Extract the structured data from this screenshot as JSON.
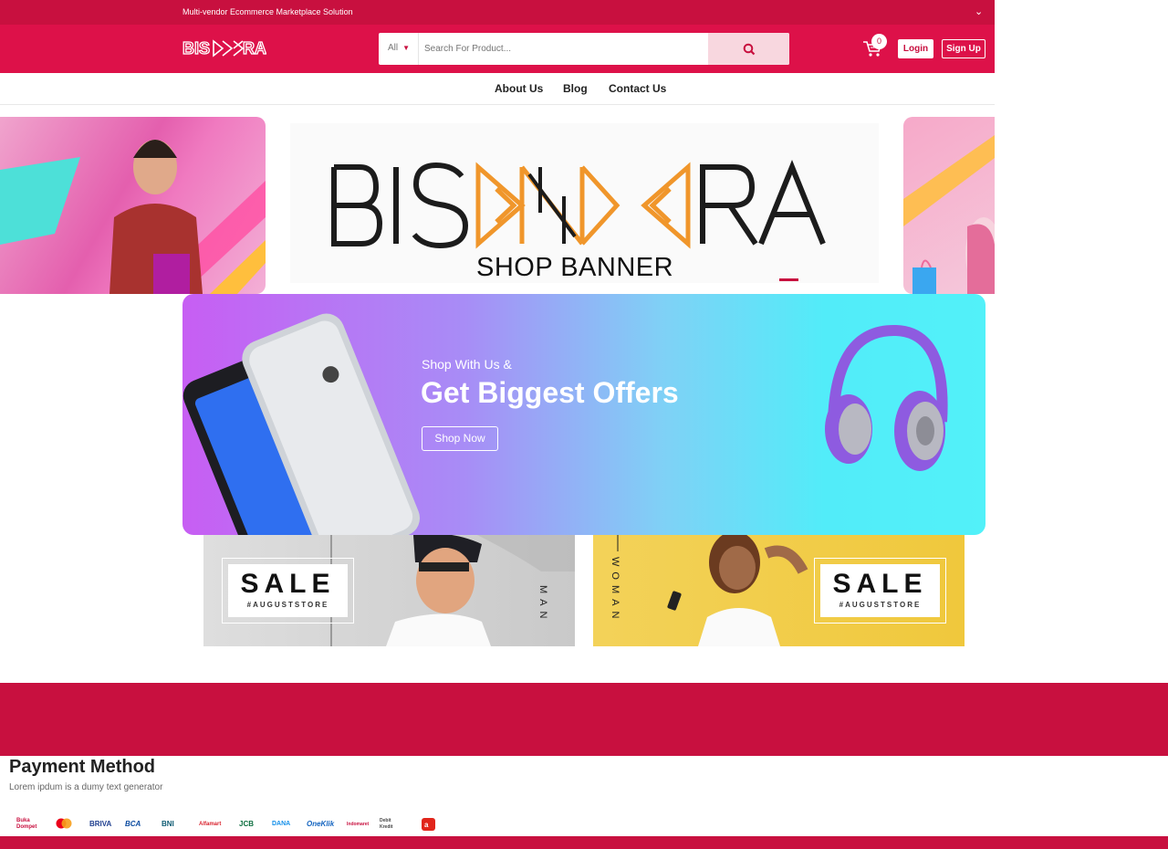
{
  "topbar": {
    "tagline": "Multi-vendor Ecommerce Marketplace Solution"
  },
  "header": {
    "search": {
      "category": "All",
      "placeholder": "Search For Product..."
    },
    "cart_count": "0",
    "login_label": "Login",
    "signup_label": "Sign Up"
  },
  "nav": {
    "items": [
      "About Us",
      "Blog",
      "Contact Us"
    ]
  },
  "carousel": {
    "logo_text": "BISNARA",
    "caption": "SHOP BANNER"
  },
  "promo": {
    "subtitle": "Shop With Us &",
    "title": "Get Biggest Offers",
    "button": "Shop Now"
  },
  "sale_man": {
    "word": "SALE",
    "tag": "#AUGUSTSTORE",
    "side": "MAN"
  },
  "sale_woman": {
    "word": "SALE",
    "tag": "#AUGUSTSTORE",
    "side": "WOMAN"
  },
  "payment": {
    "title": "Payment Method",
    "subtitle": "Lorem ipdum is a dumy text generator",
    "methods": [
      "Buka Dompet",
      "Mastercard",
      "BRIVA",
      "BCA",
      "BNI",
      "Alfamart",
      "JCB",
      "DANA",
      "OneKlik",
      "Indomaret",
      "Debit Kredit",
      "Akulaku"
    ]
  },
  "colors": {
    "brand": "#c8103f",
    "header": "#dd1149",
    "accent_orange": "#f0962b"
  }
}
